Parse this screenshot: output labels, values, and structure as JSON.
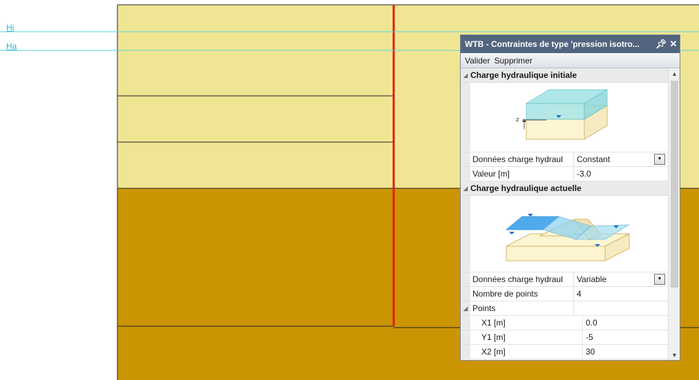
{
  "water_levels": {
    "hi_label": "Hi",
    "ha_label": "Ha"
  },
  "colors": {
    "upper_soil": "#f0e593",
    "lower_soil": "#cb9402",
    "wall": "#e21b16",
    "water_line": "#4fd6d8"
  },
  "panel": {
    "title": "WTB - Contraintes de type 'pression isotro...",
    "pin_icon": "pin-icon",
    "close_icon": "close-icon",
    "toolbar": {
      "validate": "Valider",
      "delete": "Supprimer"
    },
    "initial": {
      "category": "Charge hydraulique initiale",
      "data_label": "Données charge hydraul",
      "data_value": "Constant",
      "value_label": "Valeur [m]",
      "value_value": "-3.0",
      "axis_label": "z"
    },
    "current": {
      "category": "Charge hydraulique actuelle",
      "data_label": "Données charge hydraul",
      "data_value": "Variable",
      "points_count_label": "Nombre de points",
      "points_count_value": "4",
      "points_group_label": "Points",
      "points": [
        {
          "label": "X1 [m]",
          "value": "0.0"
        },
        {
          "label": "Y1 [m]",
          "value": "-5"
        },
        {
          "label": "X2 [m]",
          "value": "30"
        }
      ]
    }
  }
}
